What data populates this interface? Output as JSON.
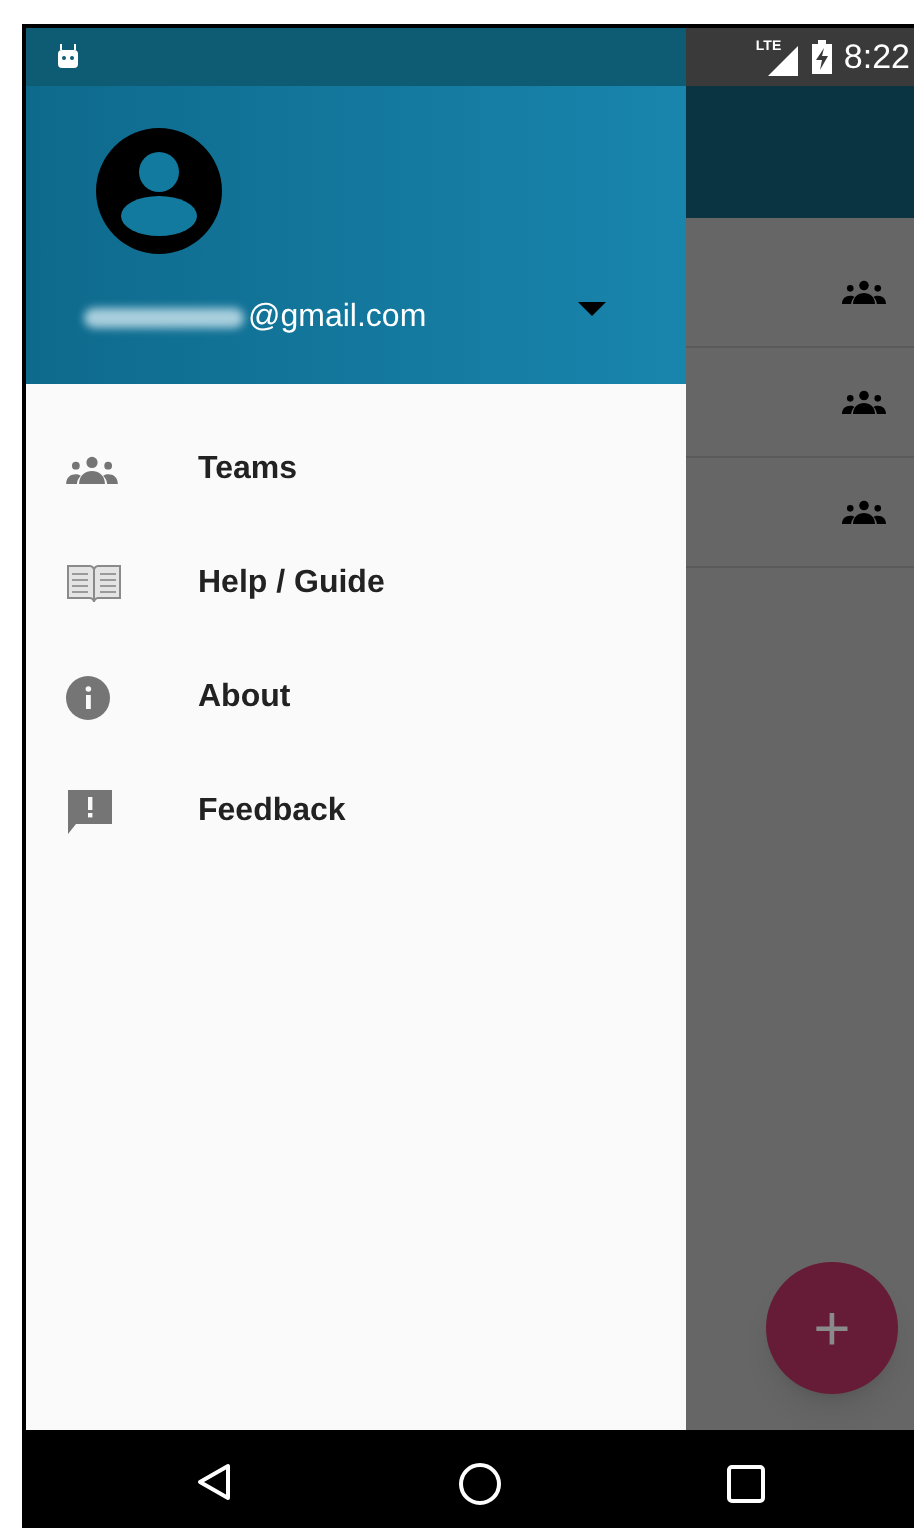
{
  "status_bar": {
    "network_label": "LTE",
    "time": "8:22"
  },
  "drawer_header": {
    "email": "@gmail.com",
    "email_redacted": true
  },
  "drawer_menu": [
    {
      "kind": "teams",
      "label": "Teams"
    },
    {
      "kind": "guide",
      "label": "Help / Guide"
    },
    {
      "kind": "info",
      "label": "About"
    },
    {
      "kind": "feedback",
      "label": "Feedback"
    }
  ],
  "background_list": [
    {
      "kind": "team"
    },
    {
      "kind": "team"
    },
    {
      "kind": "team"
    }
  ],
  "fab": {
    "symbol": "+"
  }
}
